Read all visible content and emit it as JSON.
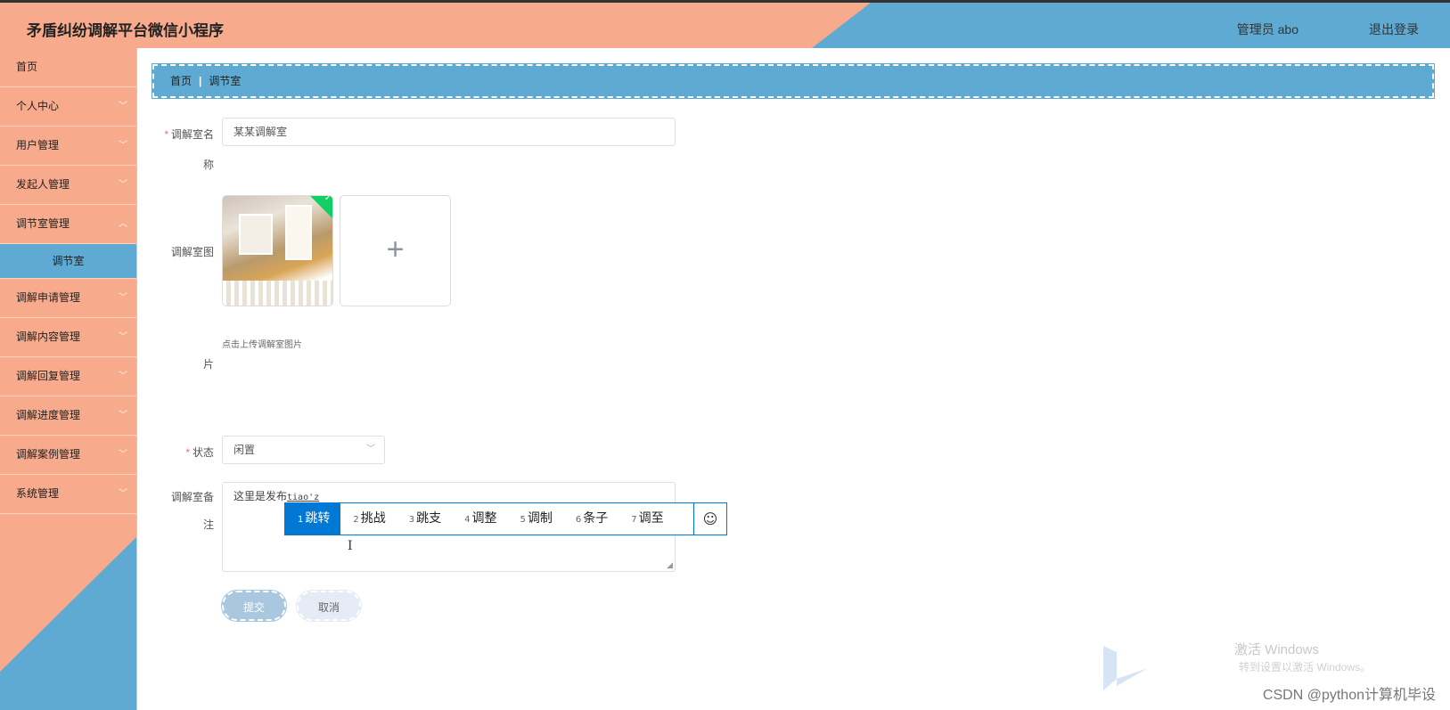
{
  "header": {
    "title": "矛盾纠纷调解平台微信小程序",
    "user": "管理员 abo",
    "logout": "退出登录",
    "colors": {
      "peach": "#f8aa8c",
      "blue": "#5eaad2"
    }
  },
  "sidebar": {
    "items": [
      {
        "label": "首页",
        "has_arrow": false
      },
      {
        "label": "个人中心",
        "has_arrow": true
      },
      {
        "label": "用户管理",
        "has_arrow": true
      },
      {
        "label": "发起人管理",
        "has_arrow": true
      },
      {
        "label": "调节室管理",
        "has_arrow": true,
        "expanded": true
      },
      {
        "label": "调节室",
        "sub": true,
        "active": true
      },
      {
        "label": "调解申请管理",
        "has_arrow": true
      },
      {
        "label": "调解内容管理",
        "has_arrow": true
      },
      {
        "label": "调解回复管理",
        "has_arrow": true
      },
      {
        "label": "调解进度管理",
        "has_arrow": true
      },
      {
        "label": "调解案例管理",
        "has_arrow": true
      },
      {
        "label": "系统管理",
        "has_arrow": true
      }
    ]
  },
  "breadcrumb": {
    "home": "首页",
    "current": "调节室"
  },
  "form": {
    "name_label_a": "调解室名",
    "name_label_b": "称",
    "name_value": "某某调解室",
    "image_label": "调解室图",
    "image_label_b": "片",
    "upload_tip": "点击上传调解室图片",
    "status_label": "状态",
    "status_value": "闲置",
    "remark_label_a": "调解室备",
    "remark_label_b": "注",
    "remark_text": "这里是发布",
    "remark_pinyin": "tiao'z",
    "submit": "提交",
    "cancel": "取消"
  },
  "ime": {
    "candidates": [
      {
        "n": "1",
        "text": "跳转",
        "active": true
      },
      {
        "n": "2",
        "text": "挑战"
      },
      {
        "n": "3",
        "text": "跳支"
      },
      {
        "n": "4",
        "text": "调整"
      },
      {
        "n": "5",
        "text": "调制"
      },
      {
        "n": "6",
        "text": "条子"
      },
      {
        "n": "7",
        "text": "调至"
      }
    ],
    "emoji": "☺"
  },
  "watermark": {
    "activate": "激活 Windows",
    "activate_sub": "转到设置以激活 Windows。",
    "csdn": "CSDN @python计算机毕设"
  }
}
